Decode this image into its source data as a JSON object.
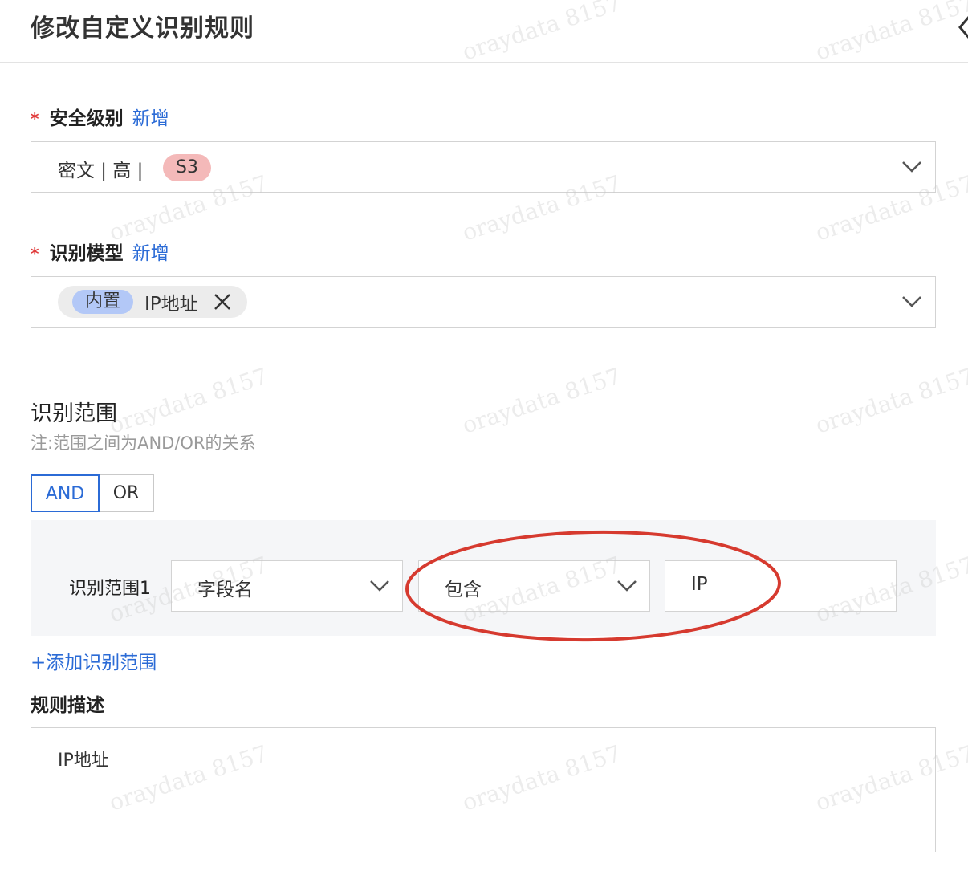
{
  "dialog": {
    "title": "修改自定义识别规则"
  },
  "security_level": {
    "required_mark": "*",
    "label": "安全级别",
    "add_link": "新增",
    "selected_text": "密文 | 高 |",
    "badge": "S3",
    "badge_color": "#f4b9b9"
  },
  "model": {
    "required_mark": "*",
    "label": "识别模型",
    "add_link": "新增",
    "tag_type": "内置",
    "tag_name": "IP地址",
    "tag_type_color": "#b3c8f7"
  },
  "scope": {
    "title": "识别范围",
    "note": "注:范围之间为AND/OR的关系",
    "and_label": "AND",
    "or_label": "OR",
    "selected_logic": "AND",
    "rows": [
      {
        "label": "识别范围1",
        "field": "字段名",
        "operator": "包含",
        "value": "IP"
      }
    ],
    "add_link": "+添加识别范围"
  },
  "description": {
    "label": "规则描述",
    "value": "IP地址"
  },
  "watermark": "oraydata 8157",
  "colors": {
    "accent": "#2b6bd6",
    "required": "#e03a3a",
    "annotation": "#d63a2f"
  }
}
